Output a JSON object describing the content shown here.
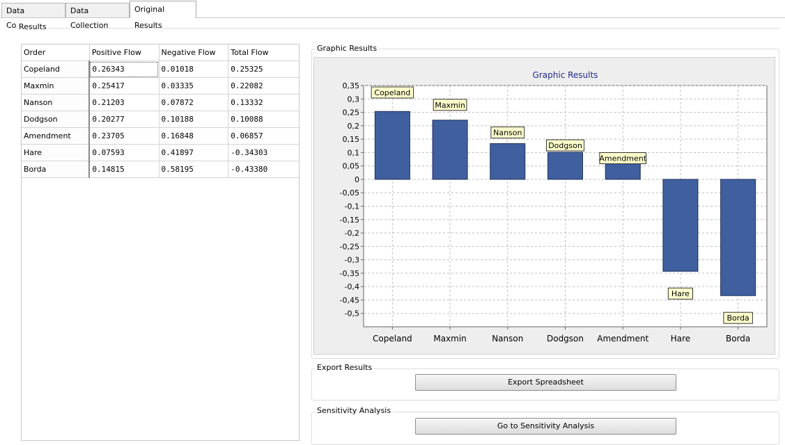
{
  "tabs": [
    {
      "label": "Data Collection"
    },
    {
      "label": "Data Collection"
    },
    {
      "label": "Original Results"
    }
  ],
  "results": {
    "legend": "Results",
    "columns": [
      "Order",
      "Positive Flow",
      "Negative Flow",
      "Total Flow"
    ],
    "rows": [
      {
        "name": "Copeland",
        "positive": "0.26343",
        "negative": "0.01018",
        "total": "0.25325"
      },
      {
        "name": "Maxmin",
        "positive": "0.25417",
        "negative": "0.03335",
        "total": "0.22082"
      },
      {
        "name": "Nanson",
        "positive": "0.21203",
        "negative": "0.07872",
        "total": "0.13332"
      },
      {
        "name": "Dodgson",
        "positive": "0.20277",
        "negative": "0.10188",
        "total": "0.10088"
      },
      {
        "name": "Amendment",
        "positive": "0.23705",
        "negative": "0.16848",
        "total": "0.06857"
      },
      {
        "name": "Hare",
        "positive": "0.07593",
        "negative": "0.41897",
        "total": "-0.34303"
      },
      {
        "name": "Borda",
        "positive": "0.14815",
        "negative": "0.58195",
        "total": "-0.43380"
      }
    ]
  },
  "graphic": {
    "legend": "Graphic Results"
  },
  "chart_data": {
    "type": "bar",
    "title": "Graphic Results",
    "categories": [
      "Copeland",
      "Maxmin",
      "Nanson",
      "Dodgson",
      "Amendment",
      "Hare",
      "Borda"
    ],
    "values": [
      0.25325,
      0.22082,
      0.13332,
      0.10088,
      0.06857,
      -0.34303,
      -0.4338
    ],
    "data_labels": [
      "Copeland",
      "Maxmin",
      "Nanson",
      "Dodgson",
      "Amendment",
      "Hare",
      "Borda"
    ],
    "yticks": [
      "0,35",
      "0,3",
      "0,25",
      "0,2",
      "0,15",
      "0,1",
      "0,05",
      "0",
      "-0,05",
      "-0,1",
      "-0,15",
      "-0,2",
      "-0,25",
      "-0,3",
      "-0,35",
      "-0,4",
      "-0,45",
      "-0,5"
    ],
    "ylim": [
      -0.55,
      0.35
    ],
    "grid": true,
    "bar_color": "#3f5f9f",
    "title_color": "#1f2a8c"
  },
  "export": {
    "legend": "Export Results",
    "button": "Export Spreadsheet"
  },
  "sensitivity": {
    "legend": "Sensitivity Analysis",
    "button": "Go to Sensitivity Analysis"
  }
}
